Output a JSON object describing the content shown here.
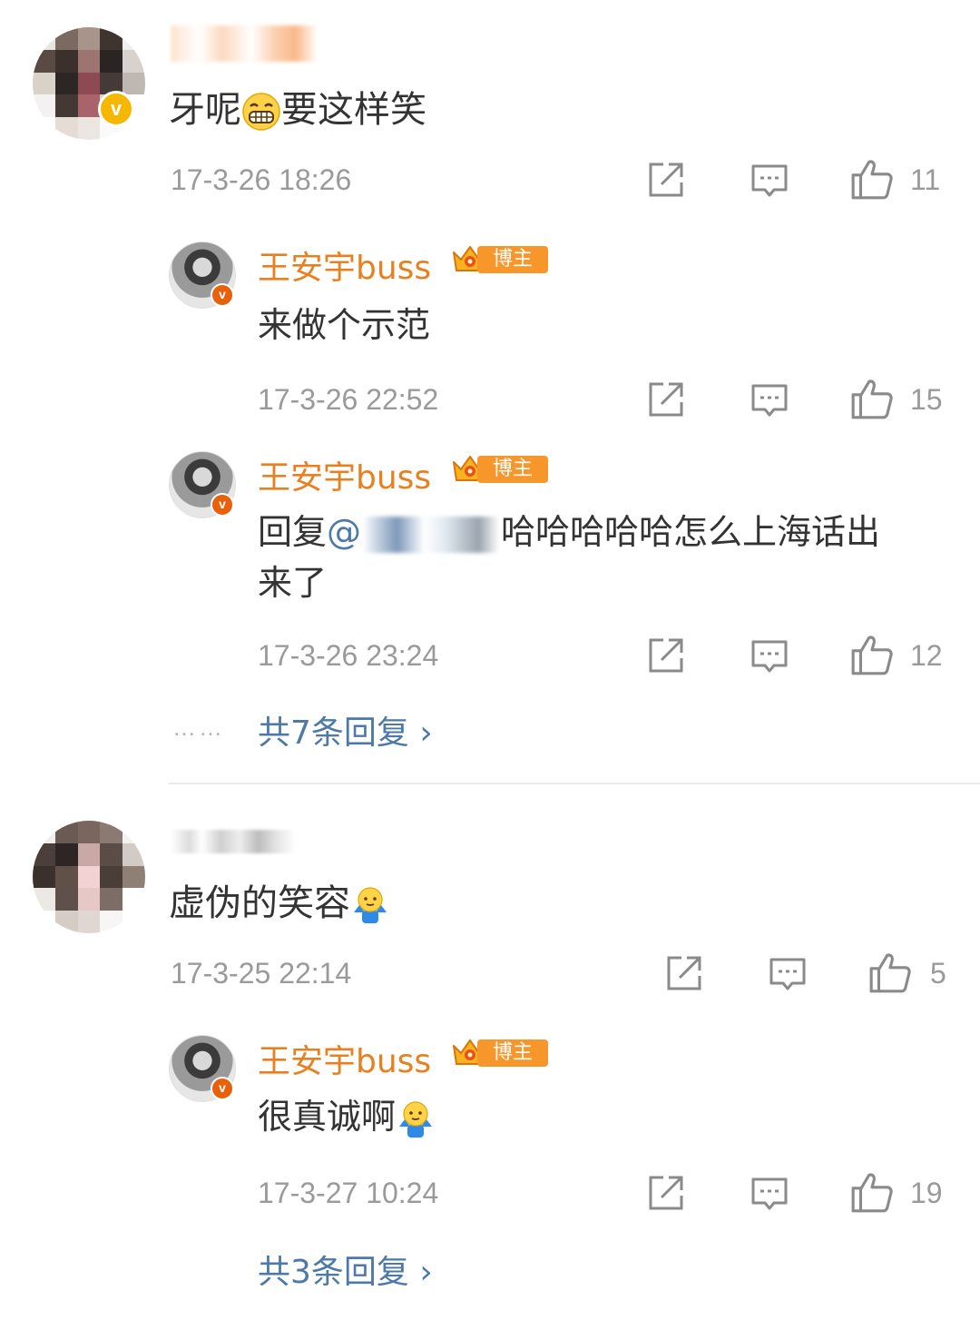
{
  "comments": [
    {
      "text_before": "牙呢",
      "emoji": "grin-emoji",
      "text_after": "要这样笑",
      "time": "17-3-26 18:26",
      "likes": "11",
      "replies": [
        {
          "username": "王安宇buss",
          "badge": "博主",
          "text": "来做个示范",
          "time": "17-3-26 22:52",
          "likes": "15"
        },
        {
          "username": "王安宇buss",
          "badge": "博主",
          "prefix": "回复",
          "mention_at": "@",
          "text_rest": "哈哈哈哈哈怎么上海话出",
          "text_line2": "来了",
          "time": "17-3-26 23:24",
          "likes": "12"
        }
      ],
      "more_dots": "……",
      "more_replies": "共7条回复 ›"
    },
    {
      "text": "虚伪的笑容",
      "emoji": "shrug-emoji",
      "time": "17-3-25 22:14",
      "likes": "5",
      "replies": [
        {
          "username": "王安宇buss",
          "badge": "博主",
          "text": "很真诚啊",
          "emoji": "shrug-emoji",
          "time": "17-3-27 10:24",
          "likes": "19"
        }
      ],
      "more_replies": "共3条回复 ›"
    }
  ],
  "icons": {
    "repost": "repost-icon",
    "comment": "comment-icon",
    "like": "like-icon"
  },
  "colors": {
    "username": "#e8801f",
    "link": "#4d79a8",
    "meta": "#9a9a9a",
    "text": "#333333"
  }
}
